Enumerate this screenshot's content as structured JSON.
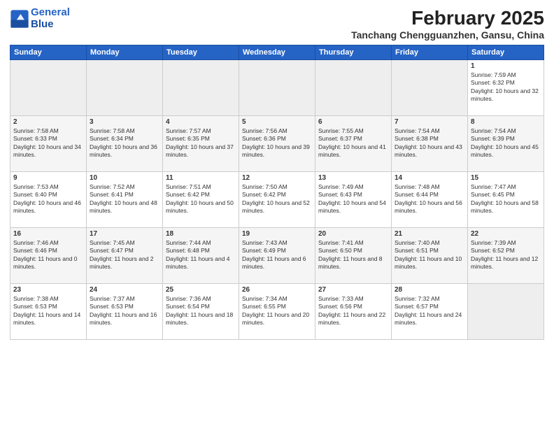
{
  "logo": {
    "line1": "General",
    "line2": "Blue"
  },
  "title": "February 2025",
  "subtitle": "Tanchang Chengguanzhen, Gansu, China",
  "weekdays": [
    "Sunday",
    "Monday",
    "Tuesday",
    "Wednesday",
    "Thursday",
    "Friday",
    "Saturday"
  ],
  "weeks": [
    [
      {
        "day": "",
        "info": ""
      },
      {
        "day": "",
        "info": ""
      },
      {
        "day": "",
        "info": ""
      },
      {
        "day": "",
        "info": ""
      },
      {
        "day": "",
        "info": ""
      },
      {
        "day": "",
        "info": ""
      },
      {
        "day": "1",
        "info": "Sunrise: 7:59 AM\nSunset: 6:32 PM\nDaylight: 10 hours and 32 minutes."
      }
    ],
    [
      {
        "day": "2",
        "info": "Sunrise: 7:58 AM\nSunset: 6:33 PM\nDaylight: 10 hours and 34 minutes."
      },
      {
        "day": "3",
        "info": "Sunrise: 7:58 AM\nSunset: 6:34 PM\nDaylight: 10 hours and 36 minutes."
      },
      {
        "day": "4",
        "info": "Sunrise: 7:57 AM\nSunset: 6:35 PM\nDaylight: 10 hours and 37 minutes."
      },
      {
        "day": "5",
        "info": "Sunrise: 7:56 AM\nSunset: 6:36 PM\nDaylight: 10 hours and 39 minutes."
      },
      {
        "day": "6",
        "info": "Sunrise: 7:55 AM\nSunset: 6:37 PM\nDaylight: 10 hours and 41 minutes."
      },
      {
        "day": "7",
        "info": "Sunrise: 7:54 AM\nSunset: 6:38 PM\nDaylight: 10 hours and 43 minutes."
      },
      {
        "day": "8",
        "info": "Sunrise: 7:54 AM\nSunset: 6:39 PM\nDaylight: 10 hours and 45 minutes."
      }
    ],
    [
      {
        "day": "9",
        "info": "Sunrise: 7:53 AM\nSunset: 6:40 PM\nDaylight: 10 hours and 46 minutes."
      },
      {
        "day": "10",
        "info": "Sunrise: 7:52 AM\nSunset: 6:41 PM\nDaylight: 10 hours and 48 minutes."
      },
      {
        "day": "11",
        "info": "Sunrise: 7:51 AM\nSunset: 6:42 PM\nDaylight: 10 hours and 50 minutes."
      },
      {
        "day": "12",
        "info": "Sunrise: 7:50 AM\nSunset: 6:42 PM\nDaylight: 10 hours and 52 minutes."
      },
      {
        "day": "13",
        "info": "Sunrise: 7:49 AM\nSunset: 6:43 PM\nDaylight: 10 hours and 54 minutes."
      },
      {
        "day": "14",
        "info": "Sunrise: 7:48 AM\nSunset: 6:44 PM\nDaylight: 10 hours and 56 minutes."
      },
      {
        "day": "15",
        "info": "Sunrise: 7:47 AM\nSunset: 6:45 PM\nDaylight: 10 hours and 58 minutes."
      }
    ],
    [
      {
        "day": "16",
        "info": "Sunrise: 7:46 AM\nSunset: 6:46 PM\nDaylight: 11 hours and 0 minutes."
      },
      {
        "day": "17",
        "info": "Sunrise: 7:45 AM\nSunset: 6:47 PM\nDaylight: 11 hours and 2 minutes."
      },
      {
        "day": "18",
        "info": "Sunrise: 7:44 AM\nSunset: 6:48 PM\nDaylight: 11 hours and 4 minutes."
      },
      {
        "day": "19",
        "info": "Sunrise: 7:43 AM\nSunset: 6:49 PM\nDaylight: 11 hours and 6 minutes."
      },
      {
        "day": "20",
        "info": "Sunrise: 7:41 AM\nSunset: 6:50 PM\nDaylight: 11 hours and 8 minutes."
      },
      {
        "day": "21",
        "info": "Sunrise: 7:40 AM\nSunset: 6:51 PM\nDaylight: 11 hours and 10 minutes."
      },
      {
        "day": "22",
        "info": "Sunrise: 7:39 AM\nSunset: 6:52 PM\nDaylight: 11 hours and 12 minutes."
      }
    ],
    [
      {
        "day": "23",
        "info": "Sunrise: 7:38 AM\nSunset: 6:53 PM\nDaylight: 11 hours and 14 minutes."
      },
      {
        "day": "24",
        "info": "Sunrise: 7:37 AM\nSunset: 6:53 PM\nDaylight: 11 hours and 16 minutes."
      },
      {
        "day": "25",
        "info": "Sunrise: 7:36 AM\nSunset: 6:54 PM\nDaylight: 11 hours and 18 minutes."
      },
      {
        "day": "26",
        "info": "Sunrise: 7:34 AM\nSunset: 6:55 PM\nDaylight: 11 hours and 20 minutes."
      },
      {
        "day": "27",
        "info": "Sunrise: 7:33 AM\nSunset: 6:56 PM\nDaylight: 11 hours and 22 minutes."
      },
      {
        "day": "28",
        "info": "Sunrise: 7:32 AM\nSunset: 6:57 PM\nDaylight: 11 hours and 24 minutes."
      },
      {
        "day": "",
        "info": ""
      }
    ]
  ]
}
